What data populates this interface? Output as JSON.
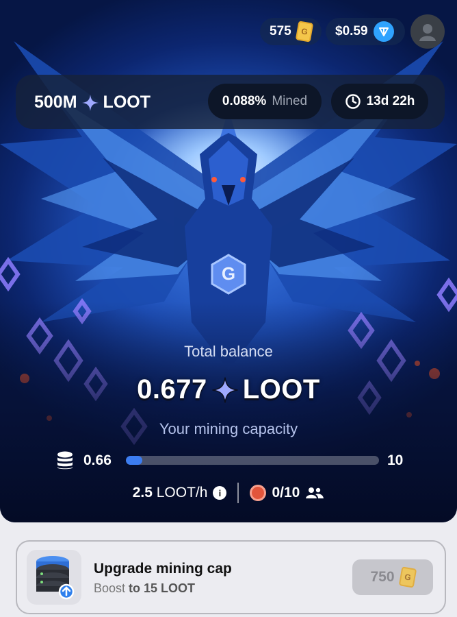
{
  "header": {
    "tickets": "575",
    "ton_balance": "$0.59",
    "ticket_icon": "ticket-g-icon",
    "ton_icon": "ton-coin-icon",
    "avatar_icon": "user-avatar-icon"
  },
  "infobar": {
    "supply_amount": "500M",
    "supply_token": "LOOT",
    "mined_percent": "0.088%",
    "mined_label": "Mined",
    "time_left": "13d 22h"
  },
  "balance": {
    "label": "Total balance",
    "amount": "0.677",
    "token": "LOOT"
  },
  "mining": {
    "capacity_label": "Your mining capacity",
    "current": "0.66",
    "max": "10",
    "fill_fraction": 0.066,
    "rate_value": "2.5",
    "rate_unit": "LOOT/h",
    "friends": "0/10"
  },
  "upgrade": {
    "title": "Upgrade mining cap",
    "sub_prefix": "Boost",
    "sub_bold": "to 15 LOOT",
    "price": "750"
  },
  "colors": {
    "accent": "#3c7df1",
    "diamond": "#9fa9ff",
    "ticket": "#f4c64a",
    "ton": "#2fa3ff"
  }
}
